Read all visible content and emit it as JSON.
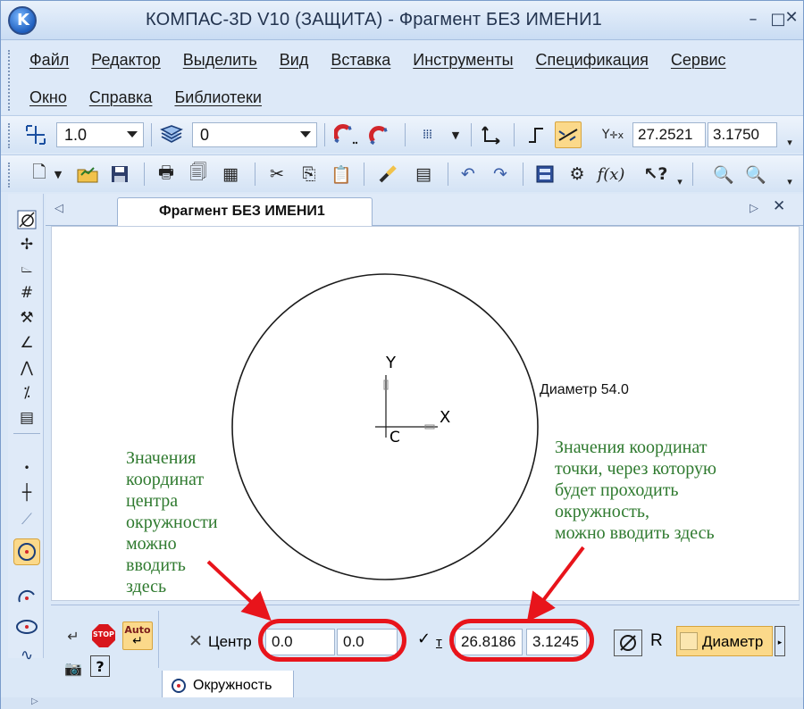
{
  "window": {
    "title": "КОМПАС-3D V10 (ЗАЩИТА) - Фрагмент БЕЗ ИМЕНИ1"
  },
  "menu": {
    "row1": [
      "Файл",
      "Редактор",
      "Выделить",
      "Вид",
      "Вставка",
      "Инструменты",
      "Спецификация",
      "Сервис"
    ],
    "row2": [
      "Окно",
      "Справка",
      "Библиотеки"
    ]
  },
  "toolbar1": {
    "step": "1.0",
    "layer": "0",
    "coord_x": "27.2521",
    "coord_y": "3.1750"
  },
  "doc_tab": {
    "title": "Фрагмент БЕЗ ИМЕНИ1"
  },
  "canvas": {
    "axis_x": "X",
    "axis_y": "Y",
    "origin": "C",
    "dimension_label": "Диаметр 54.0"
  },
  "annotations": {
    "left": "Значения\nкоординат\nцентра\nокружности\nможно\nвводить\nздесь",
    "right": "Значения координат\nточки, через которую\nбудет проходить\nокружность,\nможно вводить здесь",
    "color": "#2f7a2f",
    "highlight_color": "#e8141b"
  },
  "properties": {
    "center_label": "Центр",
    "center_x": "0.0",
    "center_y": "0.0",
    "point_label": "т",
    "point_x": "26.8186",
    "point_y": "3.1245",
    "r_label": "R",
    "diameter_label": "Диаметр",
    "stop_label": "STOP",
    "auto_label": "Auto"
  },
  "bottom_tab": {
    "label": "Окружность"
  }
}
